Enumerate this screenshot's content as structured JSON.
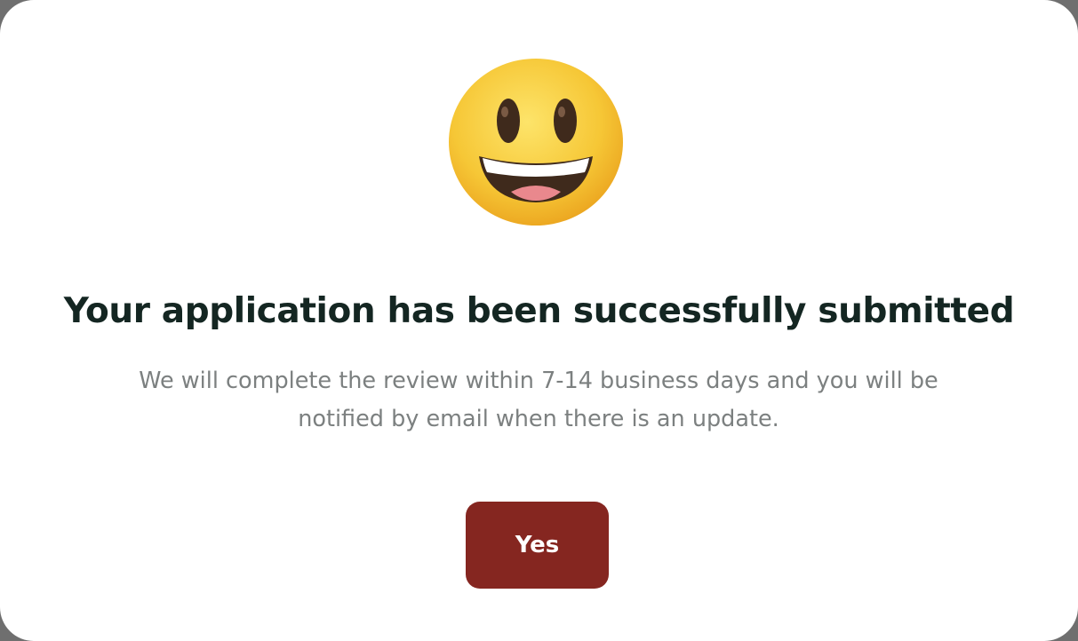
{
  "dialog": {
    "icon": "grinning-face-emoji",
    "title": "Your application has been successfully submitted",
    "message": "We will complete the review within 7-14 business days and you will be notified by email when there is an update.",
    "confirm_label": "Yes"
  },
  "colors": {
    "title": "#142622",
    "message": "#7c8080",
    "button_bg": "#852620",
    "button_text": "#ffffff",
    "dialog_bg": "#ffffff"
  }
}
